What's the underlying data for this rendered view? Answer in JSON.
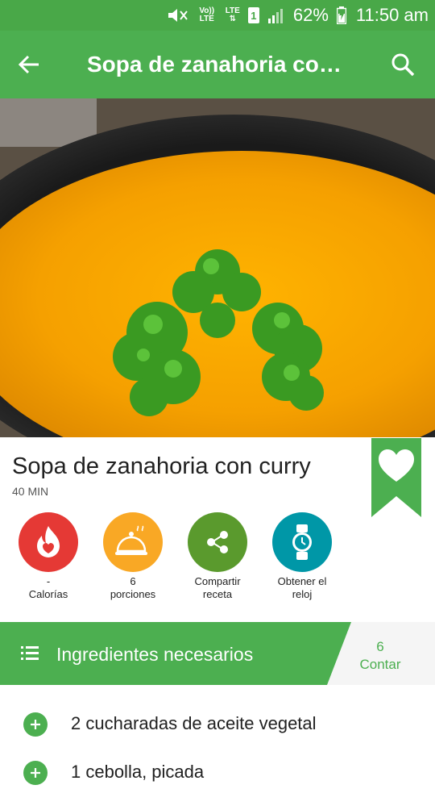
{
  "status_bar": {
    "volte": "Vo)) LTE",
    "lte": "LTE",
    "sim": "1",
    "battery": "62%",
    "time": "11:50 am"
  },
  "app_bar": {
    "title": "Sopa de zanahoria con…"
  },
  "recipe": {
    "title": "Sopa de zanahoria con curry",
    "time": "40 MIN"
  },
  "stats": {
    "calories_value": "-",
    "calories_label": "Calorías",
    "portions_value": "6",
    "portions_label": "porciones",
    "share_label_1": "Compartir",
    "share_label_2": "receta",
    "clock_label_1": "Obtener el",
    "clock_label_2": "reloj"
  },
  "ingredients_header": {
    "label": "Ingredientes necesarios",
    "count": "6",
    "count_label": "Contar"
  },
  "ingredients": [
    {
      "text": "2 cucharadas de aceite vegetal"
    },
    {
      "text": "1 cebolla, picada"
    }
  ],
  "colors": {
    "primary": "#4caf50",
    "calories": "#e53935",
    "portions": "#f9a825",
    "share": "#5a9a2d",
    "clock": "#0097a7"
  },
  "icons": [
    "back-arrow-icon",
    "search-icon",
    "heart-icon",
    "flame-icon",
    "cloche-icon",
    "share-icon",
    "watch-icon",
    "list-icon",
    "plus-icon"
  ]
}
